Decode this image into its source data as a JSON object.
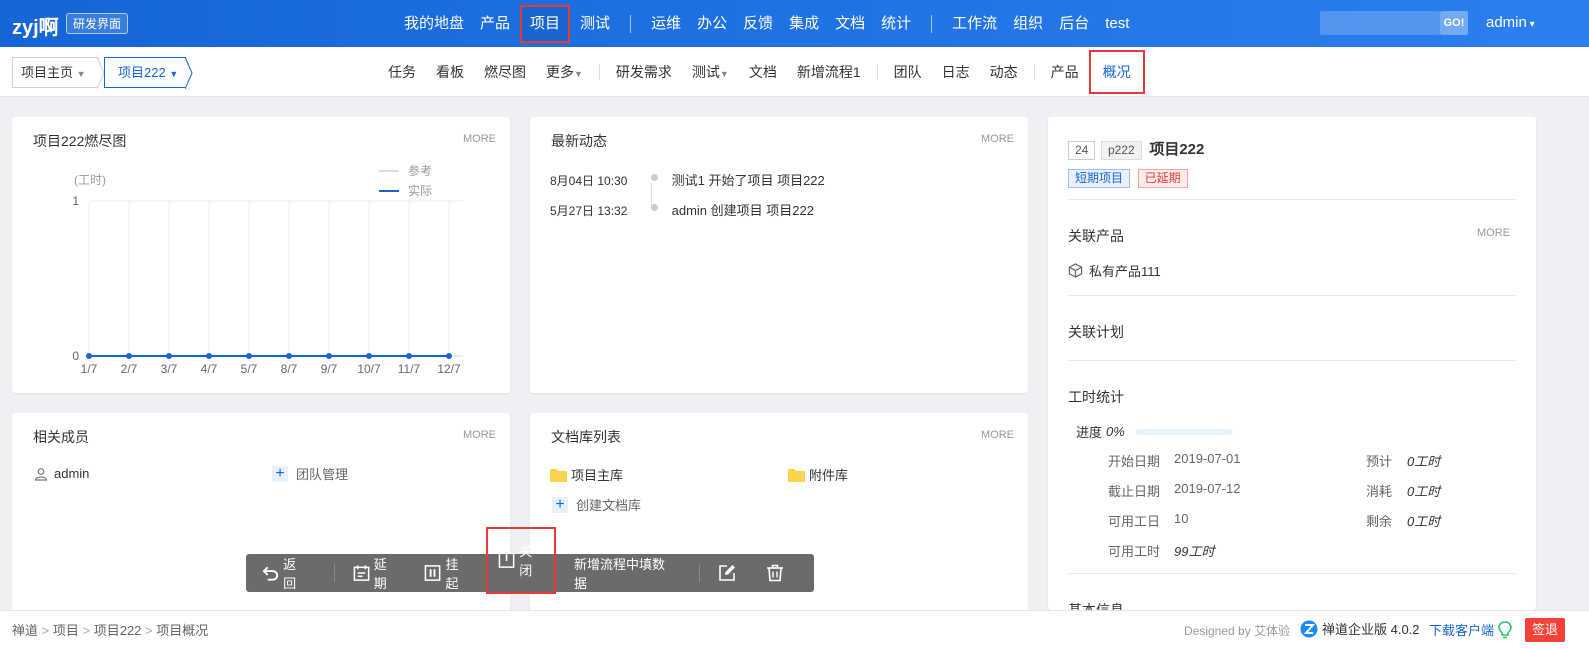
{
  "brand": {
    "name": "zyj啊",
    "tag": "研发界面"
  },
  "nav": {
    "items": [
      "我的地盘",
      "产品",
      "项目",
      "测试",
      "运维",
      "办公",
      "反馈",
      "集成",
      "文档",
      "统计",
      "工作流",
      "组织",
      "后台",
      "test"
    ],
    "go_label": "GO!",
    "user": "admin"
  },
  "subnav": {
    "crumb_home": "项目主页",
    "crumb_project": "项目222",
    "items": [
      "任务",
      "看板",
      "燃尽图",
      "更多",
      "研发需求",
      "测试",
      "文档",
      "新增流程1",
      "团队",
      "日志",
      "动态",
      "产品",
      "概况"
    ]
  },
  "burndown": {
    "title": "项目222燃尽图",
    "more": "MORE",
    "unit": "(工时)",
    "legend_ref": "参考",
    "legend_actual": "实际"
  },
  "chart_data": {
    "type": "line",
    "x": [
      "1/7",
      "2/7",
      "3/7",
      "4/7",
      "5/7",
      "8/7",
      "9/7",
      "10/7",
      "11/7",
      "12/7"
    ],
    "series": [
      {
        "name": "实际",
        "values": [
          0,
          0,
          0,
          0,
          0,
          0,
          0,
          0,
          0,
          0
        ]
      }
    ],
    "ylabel": "(工时)",
    "yticks": [
      "1",
      "0"
    ],
    "ylim": [
      0,
      1
    ]
  },
  "activity": {
    "title": "最新动态",
    "more": "MORE",
    "entries": [
      {
        "time": "8月04日 10:30",
        "text": "测试1 开始了项目 项目222"
      },
      {
        "time": "5月27日 13:32",
        "text": "admin 创建项目 项目222"
      }
    ]
  },
  "overview": {
    "id": "24",
    "code": "p222",
    "name": "项目222",
    "badge_type": "短期项目",
    "badge_status": "已延期",
    "linked_product_title": "关联产品",
    "more": "MORE",
    "product": "私有产品111",
    "linked_plan_title": "关联计划",
    "hours_title": "工时统计",
    "progress_label": "进度",
    "progress_value": "0%",
    "rows": [
      {
        "k": "开始日期",
        "v": "2019-07-01",
        "k2": "预计",
        "v2": "0工时"
      },
      {
        "k": "截止日期",
        "v": "2019-07-12",
        "k2": "消耗",
        "v2": "0工时"
      },
      {
        "k": "可用工日",
        "v": "10",
        "k2": "剩余",
        "v2": "0工时"
      },
      {
        "k": "可用工时",
        "v": "99工时",
        "k2": "",
        "v2": ""
      }
    ],
    "basic_info": "基本信息"
  },
  "members": {
    "title": "相关成员",
    "more": "MORE",
    "user": "admin",
    "team_link": "团队管理"
  },
  "docs": {
    "title": "文档库列表",
    "more": "MORE",
    "lib1": "项目主库",
    "lib2": "附件库",
    "create": "创建文档库"
  },
  "toolbar": {
    "back": "返回",
    "delay": "延期",
    "suspend": "挂起",
    "close": "关闭",
    "workflow": "新增流程中填数据"
  },
  "footer": {
    "breadcrumb": [
      "禅道",
      "项目",
      "项目222",
      "项目概况"
    ],
    "designed": "Designed by",
    "designer": "艾体验",
    "version": "禅道企业版 4.0.2",
    "download": "下载客户端",
    "signout": "签退"
  },
  "colors": {
    "primary": "#1565d8",
    "highlight": "#e53935"
  }
}
